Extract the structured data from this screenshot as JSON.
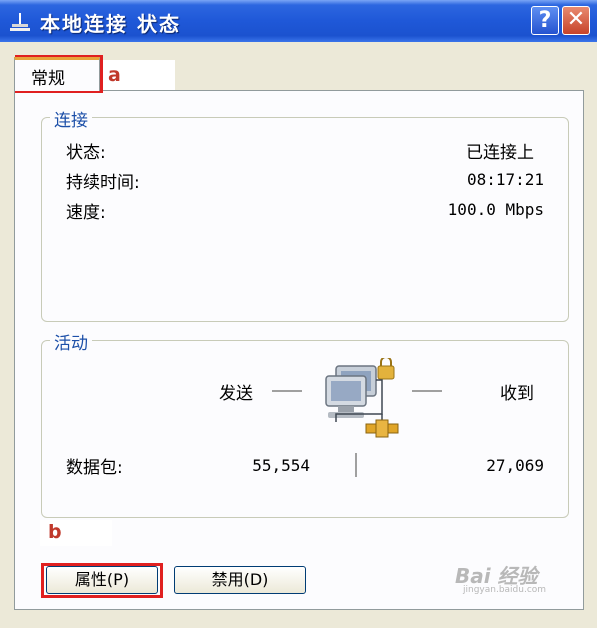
{
  "window": {
    "title": "本地连接 状态",
    "help_label": "?",
    "close_label": "✕"
  },
  "tabs": [
    {
      "label": "常规",
      "selected": true
    }
  ],
  "connection": {
    "legend": "连接",
    "rows": [
      {
        "label": "状态:",
        "value": "已连接上"
      },
      {
        "label": "持续时间:",
        "value": "08:17:21"
      },
      {
        "label": "速度:",
        "value": "100.0 Mbps"
      }
    ]
  },
  "activity": {
    "legend": "活动",
    "sent_label": "发送",
    "received_label": "收到",
    "packets_label": "数据包:",
    "sent_packets": "55,554",
    "received_packets": "27,069"
  },
  "buttons": {
    "properties": "属性(P)",
    "disable": "禁用(D)"
  },
  "annotations": {
    "a": "a",
    "b": "b",
    "highlight_color": "#e02020"
  },
  "watermark": {
    "logo": "Bai 经验",
    "url": "jingyan.baidu.com"
  },
  "colors": {
    "titlebar": "#1f58d8",
    "dialog_bg": "#ece9d8",
    "group_legend": "#1c4fa8",
    "tab_accent": "#e7a33a"
  },
  "icons": {
    "title": "network-connection-icon",
    "activity": "network-computers-icon"
  }
}
